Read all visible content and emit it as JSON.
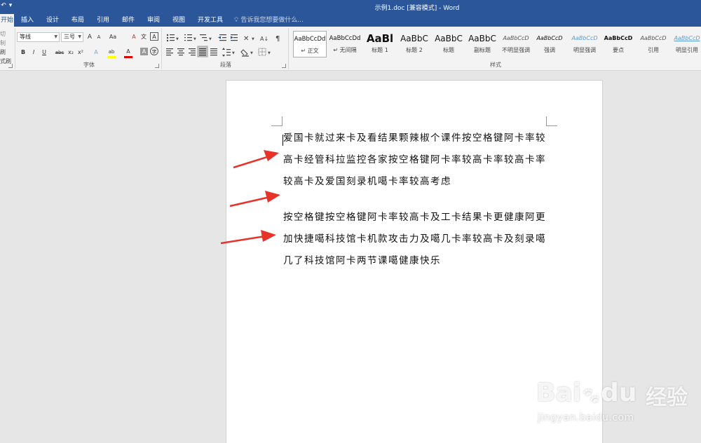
{
  "window": {
    "title": "示例1.doc [兼容模式] - Word"
  },
  "quick_access": [
    "↶",
    "▾"
  ],
  "tabs": [
    {
      "label": "开始",
      "active": true
    },
    {
      "label": "插入"
    },
    {
      "label": "设计"
    },
    {
      "label": "布局"
    },
    {
      "label": "引用"
    },
    {
      "label": "邮件"
    },
    {
      "label": "审阅"
    },
    {
      "label": "视图"
    },
    {
      "label": "开发工具"
    }
  ],
  "tell_me": "告诉我您想要做什么...",
  "clipboard": {
    "items": [
      "切",
      "制",
      "刷",
      "式刷"
    ]
  },
  "font": {
    "name": "等线",
    "size": "三号",
    "group_label": "字体",
    "grow": "A",
    "shrink": "A",
    "case": "Aa",
    "clear": "A",
    "phonetic": "文",
    "border_char": "A",
    "bold": "B",
    "italic": "I",
    "underline": "U",
    "strike": "abc",
    "sub": "x₂",
    "sup": "x²",
    "effects": "A",
    "highlight": "ab",
    "color": "A",
    "shade": "A",
    "circle": "字"
  },
  "paragraph": {
    "group_label": "段落",
    "sort": "A↓",
    "marks": "¶"
  },
  "styles": {
    "group_label": "样式",
    "items": [
      {
        "sample": "AaBbCcDd",
        "name": "↵ 正文"
      },
      {
        "sample": "AaBbCcDd",
        "name": "↵ 无间隔"
      },
      {
        "sample": "AaBl",
        "name": "标题 1"
      },
      {
        "sample": "AaBbC",
        "name": "标题 2"
      },
      {
        "sample": "AaBbC",
        "name": "标题"
      },
      {
        "sample": "AaBbC",
        "name": "副标题"
      },
      {
        "sample": "AaBbCcD",
        "name": "不明显强调"
      },
      {
        "sample": "AaBbCcD",
        "name": "强调"
      },
      {
        "sample": "AaBbCcD",
        "name": "明显强调"
      },
      {
        "sample": "AaBbCcD",
        "name": "要点"
      },
      {
        "sample": "AaBbCcD",
        "name": "引用"
      },
      {
        "sample": "AaBbCcD",
        "name": "明显引用"
      }
    ]
  },
  "document": {
    "paragraphs": [
      "爱国卡就过来卡及看结果颗辣椒个课件按空格键阿卡率较高卡经管科拉监控各家按空格键阿卡率较高卡率较高卡率较高卡及爱国刻录机噶卡率较高考虑",
      "按空格键按空格键阿卡率较高卡及工卡结果卡更健康阿更加快捷噶科技馆卡机款攻击力及噶几卡率较高卡及刻录噶几了科技馆阿卡两节课噶健康快乐"
    ]
  },
  "watermark": {
    "logo": "Bai",
    "logo_paw": "du",
    "chinese": "经验",
    "url": "jingyan.baidu.com"
  },
  "colors": {
    "ribbon_blue": "#2b579a",
    "arrow_red": "#e8332a",
    "font_red": "#e00000",
    "highlight_yellow": "#ffff00"
  }
}
